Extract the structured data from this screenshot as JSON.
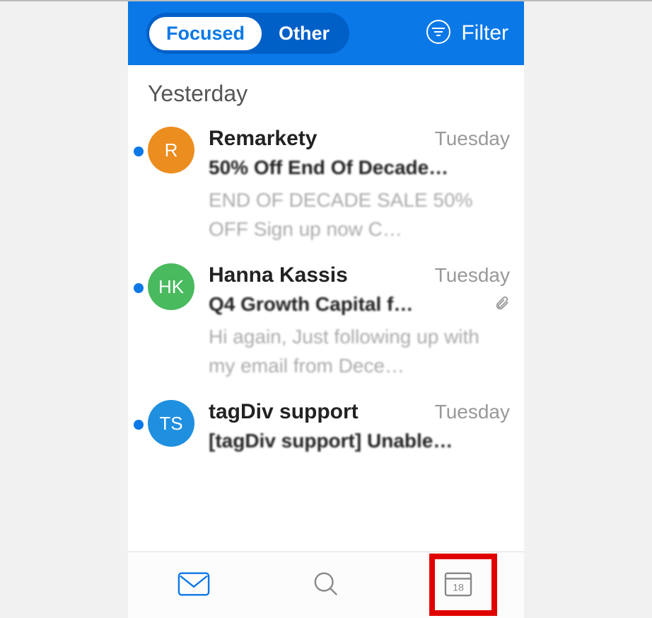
{
  "header": {
    "tabs": {
      "focused": "Focused",
      "other": "Other"
    },
    "filter_label": "Filter"
  },
  "section_header": "Yesterday",
  "emails": [
    {
      "avatar_initials": "R",
      "avatar_color": "#ec8d1f",
      "sender": "Remarkety",
      "date": "Tuesday",
      "subject": "50% Off End Of Decade…",
      "preview": "END OF DECADE SALE 50% OFF Sign up now C…",
      "has_attachment": false
    },
    {
      "avatar_initials": "HK",
      "avatar_color": "#49ba5d",
      "sender": "Hanna Kassis",
      "date": "Tuesday",
      "subject": "Q4 Growth Capital f…",
      "preview": "Hi again, Just following up with my email from Dece…",
      "has_attachment": true
    },
    {
      "avatar_initials": "TS",
      "avatar_color": "#1f8fe0",
      "sender": "tagDiv support",
      "date": "Tuesday",
      "subject": "[tagDiv support] Unable…",
      "preview": "",
      "has_attachment": false
    }
  ],
  "calendar_day": "18"
}
